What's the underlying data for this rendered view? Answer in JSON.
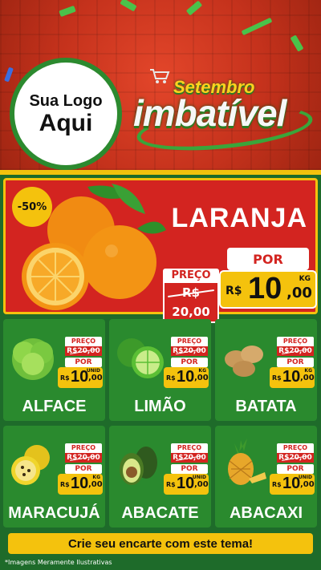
{
  "header": {
    "logo_line1": "Sua Logo",
    "logo_line2": "Aqui",
    "brand_top": "Setembro",
    "brand_main": "imbatível"
  },
  "hero": {
    "discount_badge": "-50%",
    "product": "LARANJA",
    "preco_label": "PREÇO",
    "old_price": "R$ 20,00",
    "por_label": "POR",
    "currency": "R$",
    "price_int": "10",
    "price_dec": ",00",
    "unit": "KG"
  },
  "products": [
    {
      "name": "ALFACE",
      "preco_label": "PREÇO",
      "old_price": "R$20,00",
      "por_label": "POR",
      "currency": "R$",
      "price_int": "10",
      "price_dec": ",00",
      "unit": "UNID"
    },
    {
      "name": "LIMÃO",
      "preco_label": "PREÇO",
      "old_price": "R$20,00",
      "por_label": "POR",
      "currency": "R$",
      "price_int": "10",
      "price_dec": ",00",
      "unit": "KG"
    },
    {
      "name": "BATATA",
      "preco_label": "PREÇO",
      "old_price": "R$20,00",
      "por_label": "POR",
      "currency": "R$",
      "price_int": "10",
      "price_dec": ",00",
      "unit": "KG"
    },
    {
      "name": "MARACUJÁ",
      "preco_label": "PREÇO",
      "old_price": "R$20,00",
      "por_label": "POR",
      "currency": "R$",
      "price_int": "10",
      "price_dec": ",00",
      "unit": "KG"
    },
    {
      "name": "ABACATE",
      "preco_label": "PREÇO",
      "old_price": "R$20,00",
      "por_label": "POR",
      "currency": "R$",
      "price_int": "10",
      "price_dec": ",00",
      "unit": "UNID"
    },
    {
      "name": "ABACAXI",
      "preco_label": "PREÇO",
      "old_price": "R$20,00",
      "por_label": "POR",
      "currency": "R$",
      "price_int": "10",
      "price_dec": ",00",
      "unit": "UNID"
    }
  ],
  "footer": {
    "cta": "Crie seu encarte com este tema!",
    "note": "*Imagens Meramente Ilustrativas"
  },
  "colors": {
    "header_red": "#c5321c",
    "hero_red": "#d32420",
    "card_green": "#2a8a2e",
    "background_green": "#1e6b2a",
    "price_yellow": "#f4c20d"
  },
  "icons": [
    "orange-fruit-icon",
    "lettuce-icon",
    "lime-icon",
    "potato-icon",
    "passion-fruit-icon",
    "avocado-icon",
    "pineapple-icon",
    "shopping-cart-icon"
  ]
}
